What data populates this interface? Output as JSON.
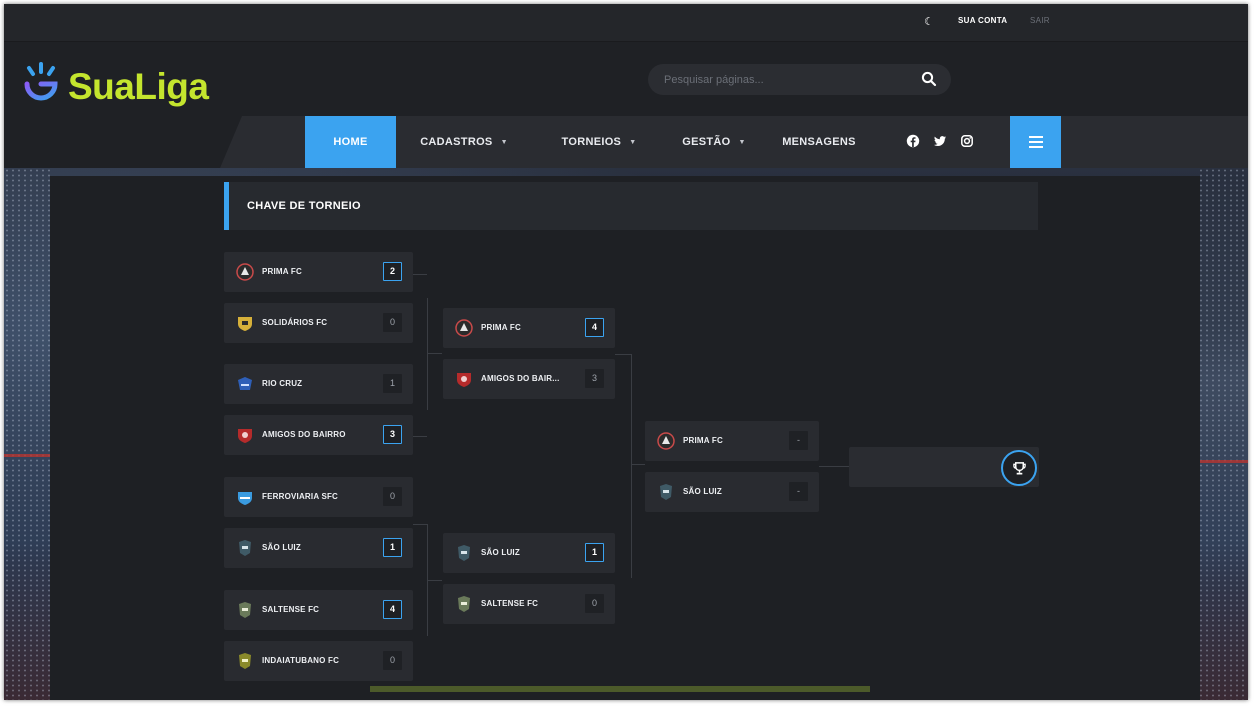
{
  "topbar": {
    "account": "SUA CONTA",
    "logout": "SAIR"
  },
  "brand": {
    "name": "SuaLiga",
    "accent_color": "#c4e52e"
  },
  "search": {
    "placeholder": "Pesquisar páginas..."
  },
  "nav": {
    "home": "HOME",
    "cadastros": "CADASTROS",
    "torneios": "TORNEIOS",
    "gestao": "GESTÃO",
    "mensagens": "MENSAGENS",
    "social": [
      "facebook-icon",
      "twitter-icon",
      "instagram-icon"
    ],
    "active_color": "#3ba3f0"
  },
  "page": {
    "title": "CHAVE DE TORNEIO"
  },
  "bracket": {
    "round1": [
      {
        "team": "PRIMA FC",
        "score": "2",
        "winner": true
      },
      {
        "team": "SOLIDÁRIOS FC",
        "score": "0",
        "winner": false
      },
      {
        "team": "RIO CRUZ",
        "score": "1",
        "winner": false
      },
      {
        "team": "AMIGOS DO BAIRRO",
        "score": "3",
        "winner": true
      },
      {
        "team": "FERROVIARIA SFC",
        "score": "0",
        "winner": false
      },
      {
        "team": "SÃO LUIZ",
        "score": "1",
        "winner": true
      },
      {
        "team": "SALTENSE FC",
        "score": "4",
        "winner": true
      },
      {
        "team": "INDAIATUBANO FC",
        "score": "0",
        "winner": false
      }
    ],
    "round2": [
      {
        "team": "PRIMA FC",
        "score": "4",
        "winner": true
      },
      {
        "team": "AMIGOS DO BAIR...",
        "score": "3",
        "winner": false
      },
      {
        "team": "SÃO LUIZ",
        "score": "1",
        "winner": true
      },
      {
        "team": "SALTENSE FC",
        "score": "0",
        "winner": false
      }
    ],
    "round3": [
      {
        "team": "PRIMA FC",
        "score": "-",
        "winner": false
      },
      {
        "team": "SÃO LUIZ",
        "score": "-",
        "winner": false
      }
    ],
    "final": {
      "icon": "trophy-icon"
    }
  }
}
